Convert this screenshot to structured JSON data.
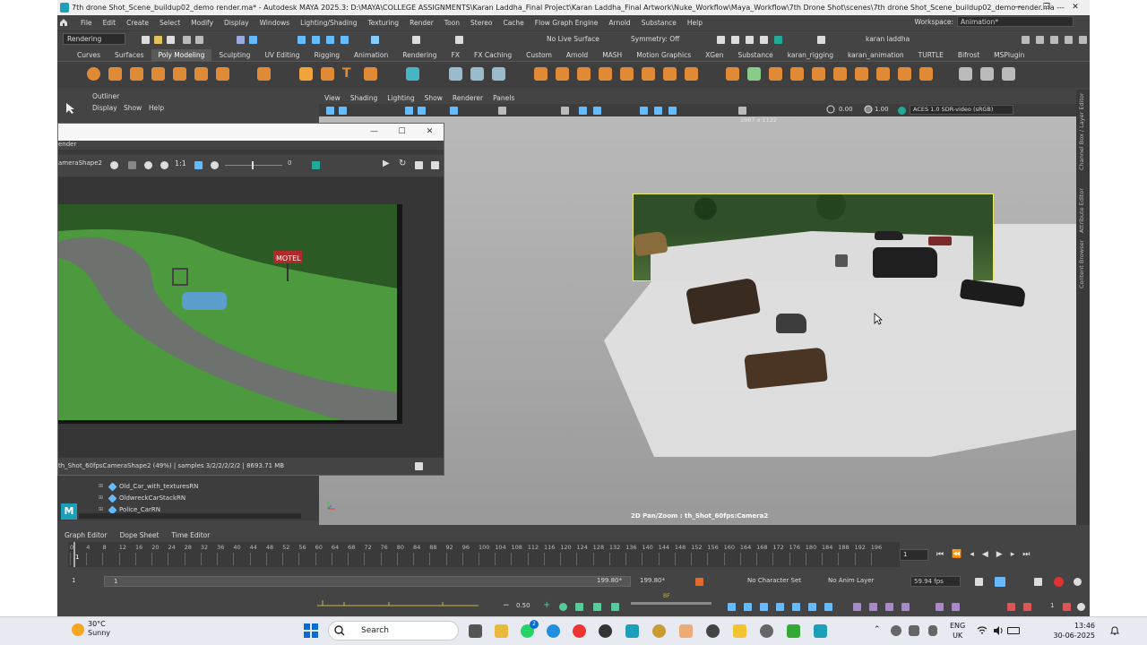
{
  "window": {
    "title": "7th drone Shot_Scene_buildup02_demo render.ma* - Autodesk MAYA 2025.3: D:\\MAYA\\COLLEGE ASSIGNMENTS\\Karan Laddha_Final Project\\Karan Laddha_Final Artwork\\Nuke_Workflow\\Maya_Workflow\\7th Drone Shot\\scenes\\7th drone Shot_Scene_buildup02_demo render.ma  ---",
    "minimize": "—",
    "restore": "❐",
    "close": "✕"
  },
  "menubar": {
    "items": [
      "File",
      "Edit",
      "Create",
      "Select",
      "Modify",
      "Display",
      "Windows",
      "Lighting/Shading",
      "Texturing",
      "Render",
      "Toon",
      "Stereo",
      "Cache",
      "Flow Graph Engine",
      "Arnold",
      "Substance",
      "Help"
    ],
    "workspace_label": "Workspace:",
    "workspace_value": "Animation*"
  },
  "statusline": {
    "menuset": "Rendering",
    "live_surface": "No Live Surface",
    "symmetry": "Symmetry: Off",
    "user": "karan laddha"
  },
  "shelf": {
    "tabs": [
      "Curves",
      "Surfaces",
      "Poly Modeling",
      "Sculpting",
      "UV Editing",
      "Rigging",
      "Animation",
      "Rendering",
      "FX",
      "FX Caching",
      "Custom",
      "Arnold",
      "MASH",
      "Motion Graphics",
      "XGen",
      "Substance",
      "karan_rigging",
      "karan_animation",
      "TURTLE",
      "Bifrost",
      "MSPlugin"
    ],
    "active_tab": "Poly Modeling"
  },
  "outliner": {
    "title": "Outliner",
    "menus": [
      "Display",
      "Show",
      "Help"
    ],
    "items": [
      "Old_Car_with_texturesRN",
      "OldwreckCarStackRN",
      "Police_CarRN"
    ]
  },
  "viewport": {
    "menus": [
      "View",
      "Shading",
      "Lighting",
      "Show",
      "Renderer",
      "Panels"
    ],
    "exposure": "0.00",
    "gamma": "1.00",
    "color_space": "ACES 1.0 SDR-video (sRGB)",
    "resolution": "1987 x 1122",
    "camera_label": "2D Pan/Zoom : th_Shot_60fps:Camera2",
    "right_panel_labels": [
      "Channel Box / Layer Editor",
      "Attribute Editor",
      "Content Browser"
    ]
  },
  "render_view": {
    "title": "ender",
    "camera": "ameraShape2",
    "ratio": "1:1",
    "slider_value": "0",
    "status": "th_Shot_60fpsCameraShape2 (49%) | samples 3/2/2/2/2/2 | 8693.71 MB",
    "sign_text": "MOTEL"
  },
  "bottom_tabs": [
    "Graph Editor",
    "Dope Sheet",
    "Time Editor"
  ],
  "timeline": {
    "ticks": [
      "0",
      "4",
      "8",
      "12",
      "16",
      "20",
      "24",
      "28",
      "32",
      "36",
      "40",
      "44",
      "48",
      "52",
      "56",
      "60",
      "64",
      "68",
      "72",
      "76",
      "80",
      "84",
      "88",
      "92",
      "96",
      "100",
      "104",
      "108",
      "112",
      "116",
      "120",
      "124",
      "128",
      "132",
      "136",
      "140",
      "144",
      "148",
      "152",
      "156",
      "160",
      "164",
      "168",
      "172",
      "176",
      "180",
      "184",
      "188",
      "192",
      "196"
    ],
    "current": "1",
    "current_field": "1"
  },
  "range": {
    "start": "1",
    "inner_start": "1",
    "end_inner": "199.80*",
    "end_outer": "199.80*",
    "character_set": "No Character Set",
    "anim_layer": "No Anim Layer",
    "fps": "59.94 fps"
  },
  "cmdline": {
    "value": "0.50",
    "tick_label": "BF",
    "page": "1"
  },
  "taskbar": {
    "temperature": "30°C",
    "condition": "Sunny",
    "search": "Search",
    "lang_top": "ENG",
    "lang_bottom": "UK",
    "time": "13:46",
    "date": "30-06-2025",
    "badge_count": "2"
  }
}
